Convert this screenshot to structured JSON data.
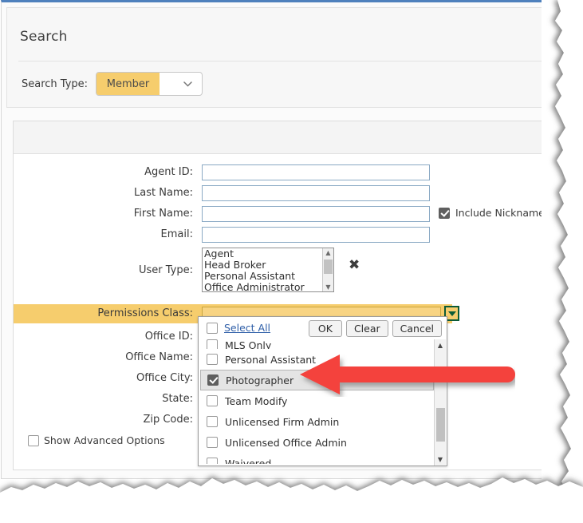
{
  "theme": {
    "accent_blue": "#4f81bd",
    "highlight_gold": "#f6cd6d",
    "arrow_red": "#f4423c",
    "link_blue": "#2f5fa8",
    "dropdown_button_green": "#0c5b36"
  },
  "search_panel": {
    "title": "Search",
    "search_type_label": "Search Type:",
    "search_type_value": "Member",
    "caret_icon": "chevron-down-icon"
  },
  "form": {
    "fields": [
      {
        "label": "Agent ID:",
        "value": "",
        "placeholder": ""
      },
      {
        "label": "Last Name:",
        "value": "",
        "placeholder": ""
      },
      {
        "label": "First Name:",
        "value": "",
        "placeholder": ""
      },
      {
        "label": "Email:",
        "value": "",
        "placeholder": ""
      }
    ],
    "include_nickname": {
      "label": "Include Nickname",
      "checked": true
    },
    "user_type": {
      "label": "User Type:",
      "options": [
        "Agent",
        "Head Broker",
        "Personal Assistant",
        "Office Administrator"
      ],
      "clear_icon": "close-x-icon",
      "scroll_up_icon": "triangle-up-icon",
      "scroll_down_icon": "triangle-down-icon"
    },
    "permissions_class": {
      "label": "Permissions Class:",
      "value": "",
      "dropdown_icon": "triangle-down-icon"
    },
    "lower_fields": [
      {
        "label": "Office ID:"
      },
      {
        "label": "Office Name:"
      },
      {
        "label": "Office City:"
      },
      {
        "label": "State:"
      },
      {
        "label": "Zip Code:"
      }
    ],
    "advanced_options": {
      "label": "Show Advanced Options",
      "checked": false
    }
  },
  "permissions_dropdown": {
    "select_all": {
      "label": "Select All",
      "checked": false
    },
    "buttons": [
      {
        "label": "OK"
      },
      {
        "label": "Clear"
      },
      {
        "label": "Cancel"
      }
    ],
    "items": [
      {
        "label": "MLS Only",
        "checked": false,
        "selected": false,
        "clipped": true
      },
      {
        "label": "Personal Assistant",
        "checked": false,
        "selected": false,
        "clipped": false
      },
      {
        "label": "Photographer",
        "checked": true,
        "selected": true,
        "clipped": false
      },
      {
        "label": "Team Modify",
        "checked": false,
        "selected": false,
        "clipped": false
      },
      {
        "label": "Unlicensed Firm Admin",
        "checked": false,
        "selected": false,
        "clipped": false
      },
      {
        "label": "Unlicensed Office Admin",
        "checked": false,
        "selected": false,
        "clipped": false
      },
      {
        "label": "Waivered",
        "checked": false,
        "selected": false,
        "clipped": false
      }
    ],
    "scroll_up_icon": "triangle-up-icon",
    "scroll_down_icon": "triangle-down-icon"
  },
  "annotation": {
    "arrow": {
      "name": "red-pointer-arrow",
      "direction": "left",
      "target": "Photographer"
    }
  }
}
